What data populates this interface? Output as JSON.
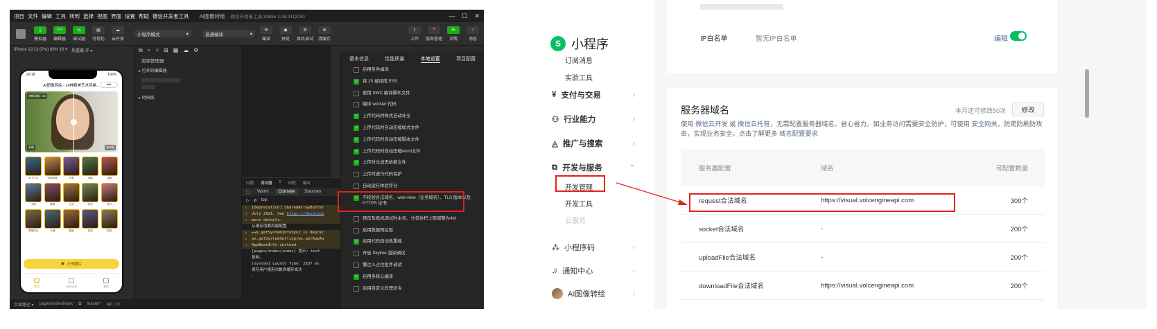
{
  "ide": {
    "menu": [
      "项目",
      "文件",
      "编辑",
      "工具",
      "转到",
      "选择",
      "视图",
      "界面",
      "设置",
      "帮助",
      "微信开发者工具"
    ],
    "title": "AI图像转绘",
    "title_sub": "- 微信开发者工具 Stable 1.06.2412050",
    "toolbar": {
      "left": [
        "模拟器",
        "编辑器",
        "调试器",
        "可视化",
        "云开发"
      ],
      "mode_select": "小程序模式",
      "compile_select": "普通编译",
      "mid": [
        "编译",
        "预览",
        "真机调试",
        "清缓存"
      ],
      "right": [
        "上传",
        "版本管理",
        "详情",
        "消息"
      ]
    },
    "sim_header": [
      "iPhone 12/13 (Pro) 89% 16 ▾",
      "热重载 开 ▾"
    ],
    "phone": {
      "time": "20:18",
      "battery": "100%",
      "nav_title": "AI图像转绘 - 24种精美艺术风格...",
      "menu": "•••",
      "hero_top_tag": "转换风格：3D",
      "hero_left_tag": "原图",
      "hero_right_tag": "效果图",
      "styles": [
        "水下少女",
        "动漫风格",
        "可爱",
        "漫画",
        "油画",
        "下雨",
        "赛博",
        "日式",
        "梦幻",
        "花卉",
        "素描风光",
        "卡通",
        "国画",
        "民族",
        "剪纸"
      ],
      "upload": "上传照片",
      "tabs": [
        "首页",
        "历史记录",
        "我的"
      ]
    },
    "explorer": {
      "title": "资源管理器",
      "rows": [
        "▸ 打开的编辑器",
        "▸ 时间线"
      ]
    },
    "debug": {
      "top_tabs": [
        "问题",
        "调试器",
        "5",
        "问题",
        "输出"
      ],
      "dev_tabs": [
        "Wxml",
        "Console",
        "Sources"
      ],
      "filter": "top",
      "logs": [
        {
          "type": "warn",
          "text": "[Deprecation] SharedArrayBuffer",
          "link": ""
        },
        {
          "type": "warn",
          "text": "July 2021. See",
          "link": "https://develope"
        },
        {
          "type": "warn",
          "text": "more details.",
          "link": ""
        },
        {
          "type": "info",
          "text": "从缓存加载风格配置",
          "link": ""
        },
        {
          "type": "warn",
          "text": "▸wx.getSystemInfoSync is deprec",
          "link": ""
        },
        {
          "type": "warn",
          "text": "wx.getSystemSetting/wx.getAppAu",
          "link": ""
        },
        {
          "type": "warn",
          "text": "AppBaseInfo instead.",
          "link": ""
        },
        {
          "type": "info",
          "text": "[pages/index/index] 提示: text",
          "link": ""
        },
        {
          "type": "info",
          "text": "复制。",
          "link": ""
        },
        {
          "type": "info",
          "text": "[system] Launch Time: 2837 ms",
          "link": ""
        },
        {
          "type": "info",
          "text": "保存用户使用次数到缓存成功",
          "link": ""
        }
      ]
    },
    "settings": {
      "tabs": [
        "基本信息",
        "性能质量",
        "本地设置",
        "项目配置"
      ],
      "active_tab": "本地设置",
      "options": [
        {
          "label": "启用条件编译",
          "checked": false
        },
        {
          "label": "将 JS 编译成 ES5",
          "checked": true
        },
        {
          "label": "使用 SWC 编译脚本文件",
          "checked": false
        },
        {
          "label": "编译 worklet 代码",
          "checked": false
        },
        {
          "label": "上传代码时样式自动补全",
          "checked": true
        },
        {
          "label": "上传代码时自动压缩样式文件",
          "checked": true
        },
        {
          "label": "上传代码时自动压缩脚本文件",
          "checked": true
        },
        {
          "label": "上传代码时自动压缩wxml文件",
          "checked": true
        },
        {
          "label": "上传时过滤无依赖文件",
          "checked": true
        },
        {
          "label": "上传时进行代码保护",
          "checked": false
        },
        {
          "label": "自动运行体验评分",
          "checked": false
        },
        {
          "label": "不校验合法域名、web-view（业务域名）、TLS 版本以及 HTTPS 证书",
          "checked": true
        },
        {
          "label": "预览及真机调试时主包、分包体积上限调整为4M",
          "checked": false
        },
        {
          "label": "启用数据预拉取",
          "checked": false
        },
        {
          "label": "启用代码自动热重载",
          "checked": true
        },
        {
          "label": "开启 Skyline 渲染调试",
          "checked": false
        },
        {
          "label": "懒注入占位组件调试",
          "checked": false
        },
        {
          "label": "启用多核心编译",
          "checked": true
        },
        {
          "label": "启用自定义处理命令",
          "checked": false
        }
      ]
    },
    "status": [
      "页面路径 ▾",
      "pages/index/index",
      "master*",
      "⊗0 ⚠0"
    ]
  },
  "console": {
    "brand": "小程序",
    "sidebar": [
      {
        "label": "订阅消息",
        "kind": "sub"
      },
      {
        "label": "实验工具",
        "kind": "sub"
      },
      {
        "label": "支付与交易",
        "kind": "item",
        "icon": "¥",
        "chev": "›"
      },
      {
        "label": "行业能力",
        "kind": "item",
        "icon": "⚇",
        "chev": "›"
      },
      {
        "label": "推广与搜索",
        "kind": "item",
        "icon": "◬",
        "chev": "›"
      },
      {
        "label": "开发与服务",
        "kind": "item",
        "icon": "⧉",
        "chev": "⌃"
      },
      {
        "label": "开发管理",
        "kind": "sub"
      },
      {
        "label": "开发工具",
        "kind": "sub"
      },
      {
        "label": "云服务",
        "kind": "sub-dim"
      },
      {
        "label": "小程序码",
        "kind": "item",
        "icon": "⁂",
        "chev": "›"
      },
      {
        "label": "通知中心",
        "kind": "item",
        "icon": "♫",
        "chev": "›"
      },
      {
        "label": "AI图像转绘",
        "kind": "account",
        "chev": "›"
      }
    ],
    "ip_whitelist": {
      "label": "IP白名单",
      "value": "暂无IP白名单",
      "edit": "编辑",
      "enabled": true
    },
    "server_domain": {
      "title": "服务器域名",
      "quota": "本月还可修改50次",
      "modify_btn": "修改",
      "desc_parts": [
        "使用 ",
        "微信云开发",
        " 或 ",
        "微信云托管",
        "，无需配置服务器域名，省心省力。如业务访问需要安全防护，可使用 ",
        "安全网关",
        "，防爬防刷防攻击，实现业务安全。点击了解更多 ",
        "域名配置要求"
      ],
      "headers": [
        "服务器配置",
        "域名",
        "可配置数量"
      ],
      "rows": [
        {
          "name": "request合法域名",
          "domain": "https://visual.volcengineapi.com",
          "count": "300个"
        },
        {
          "name": "socket合法域名",
          "domain": "-",
          "count": "200个"
        },
        {
          "name": "uploadFile合法域名",
          "domain": "-",
          "count": "200个"
        },
        {
          "name": "downloadFile合法域名",
          "domain": "https://visual.volcengineapi.com",
          "count": "200个"
        }
      ]
    }
  },
  "colors": {
    "accent_green": "#07c160",
    "ide_green": "#1aad19",
    "annotation_red": "#e2231a",
    "link_blue": "#576b95"
  }
}
